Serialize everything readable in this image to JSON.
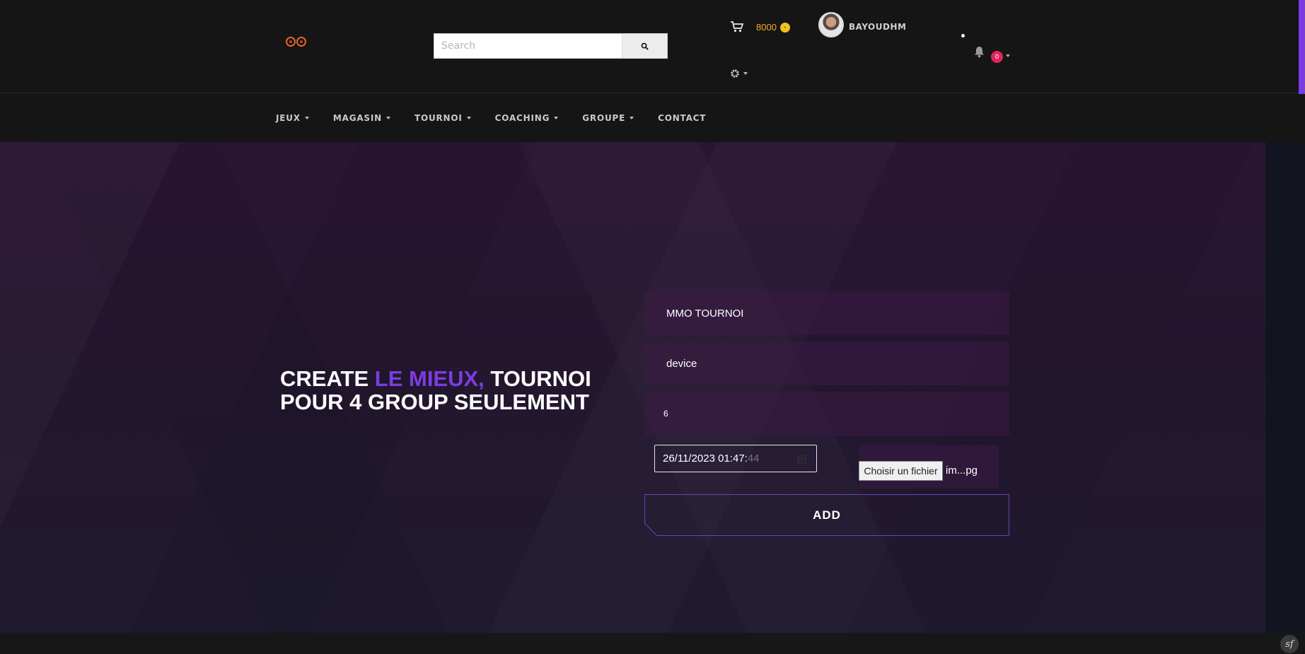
{
  "header": {
    "search": {
      "placeholder": "Search"
    },
    "coins": {
      "amount": "8000"
    },
    "user": {
      "name": "BAYOUDHM"
    },
    "notifications": {
      "count": "0"
    }
  },
  "nav": {
    "items": [
      {
        "label": "JEUX"
      },
      {
        "label": "MAGASIN"
      },
      {
        "label": "TOURNOI"
      },
      {
        "label": "COACHING"
      },
      {
        "label": "GROUPE"
      },
      {
        "label": "CONTACT"
      }
    ]
  },
  "hero": {
    "headline_part1": "CREATE ",
    "headline_accent": "LE MIEUX,",
    "headline_part2": " TOURNOI",
    "headline_line2": "POUR 4 GROUP SEULEMENT"
  },
  "form": {
    "name_value": "MMO TOURNOI",
    "device_value": "device",
    "count_value": "6",
    "datetime_value": "26/11/2023 01:47:",
    "datetime_seconds": "44",
    "file_button": "Choisir un fichier",
    "file_name": "im...pg",
    "submit": "ADD"
  },
  "colors": {
    "accent": "#7c3ce0",
    "coin": "#f2b01e",
    "badge": "#e0245e"
  }
}
